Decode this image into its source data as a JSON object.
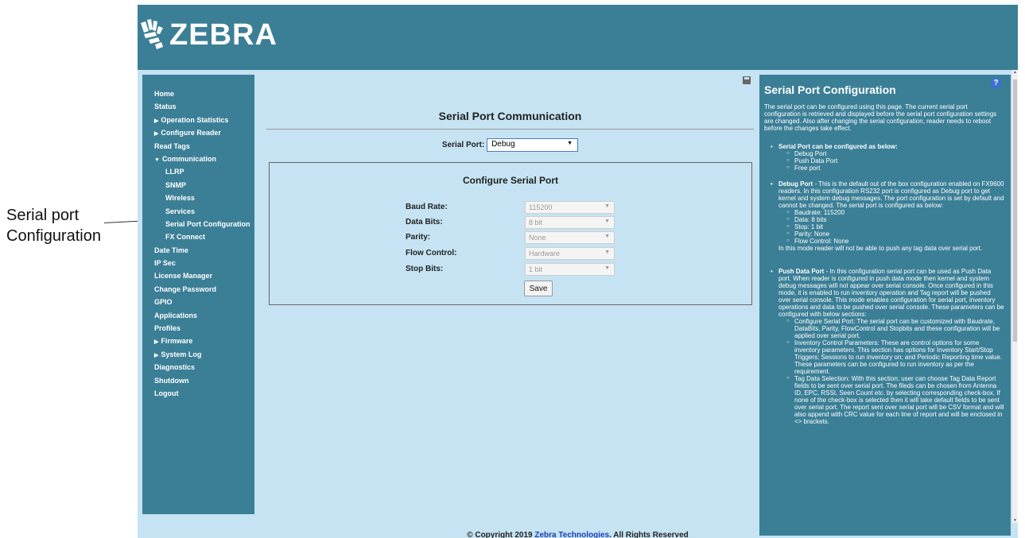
{
  "callout": {
    "line1": "Serial port",
    "line2": "Configuration"
  },
  "brand": {
    "name": "ZEBRA"
  },
  "sidebar": {
    "items": [
      {
        "label": "Home",
        "level": 0,
        "caret": ""
      },
      {
        "label": "Status",
        "level": 0,
        "caret": ""
      },
      {
        "label": "Operation Statistics",
        "level": 0,
        "caret": "▶"
      },
      {
        "label": "Configure Reader",
        "level": 0,
        "caret": "▶"
      },
      {
        "label": "Read Tags",
        "level": 0,
        "caret": ""
      },
      {
        "label": "Communication",
        "level": 0,
        "caret": "▼"
      },
      {
        "label": "LLRP",
        "level": 1,
        "caret": ""
      },
      {
        "label": "SNMP",
        "level": 1,
        "caret": ""
      },
      {
        "label": "Wireless",
        "level": 1,
        "caret": ""
      },
      {
        "label": "Services",
        "level": 1,
        "caret": ""
      },
      {
        "label": "Serial Port Configuration",
        "level": 1,
        "caret": ""
      },
      {
        "label": "FX Connect",
        "level": 1,
        "caret": ""
      },
      {
        "label": "Date Time",
        "level": 0,
        "caret": ""
      },
      {
        "label": "IP Sec",
        "level": 0,
        "caret": ""
      },
      {
        "label": "License Manager",
        "level": 0,
        "caret": ""
      },
      {
        "label": "Change Password",
        "level": 0,
        "caret": ""
      },
      {
        "label": "GPIO",
        "level": 0,
        "caret": ""
      },
      {
        "label": "Applications",
        "level": 0,
        "caret": ""
      },
      {
        "label": "Profiles",
        "level": 0,
        "caret": ""
      },
      {
        "label": "Firmware",
        "level": 0,
        "caret": "▶"
      },
      {
        "label": "System Log",
        "level": 0,
        "caret": "▶"
      },
      {
        "label": "Diagnostics",
        "level": 0,
        "caret": ""
      },
      {
        "label": "Shutdown",
        "level": 0,
        "caret": ""
      },
      {
        "label": "Logout",
        "level": 0,
        "caret": ""
      }
    ]
  },
  "main": {
    "title": "Serial Port Communication",
    "serial_port_label": "Serial Port:",
    "serial_port_value": "Debug",
    "panel_title": "Configure Serial Port",
    "fields": [
      {
        "label": "Baud Rate:",
        "value": "115200"
      },
      {
        "label": "Data Bits:",
        "value": "8 bit"
      },
      {
        "label": "Parity:",
        "value": "None"
      },
      {
        "label": "Flow Control:",
        "value": "Hardware"
      },
      {
        "label": "Stop Bits:",
        "value": "1 bit"
      }
    ],
    "save_label": "Save"
  },
  "help": {
    "title": "Serial Port Configuration",
    "intro": "The serial port can be configured using this page. The current serial port configuration is retrieved and displayed before the serial port configuration settings are changed. Also after changing the serial configuration, reader needs to reboot before the changes take effect.",
    "configurable_heading": "Serial Port can be configured as below:",
    "configurable_items": [
      "Debug Port",
      "Push Data Port",
      "Free port"
    ],
    "debug_heading": "Debug Port",
    "debug_text": " - This is the default out of the box configuration enabled on FX9600 readers. In this configuration RS232 port is configured as Debug port to get kernel and system debug messages. The port configuration is set by default and cannot be changed. The serial port is configured as below:",
    "debug_items": [
      "Baudrate: 115200",
      "Data: 8 bits",
      "Stop: 1 bit",
      "Parity: None",
      "Flow Control: None"
    ],
    "debug_note": "In this mode reader will not be able to push any tag data over serial port.",
    "push_heading": "Push Data Port",
    "push_text": " - In this configuration serial port can be used as Push Data port. When reader is configured in push data mode then kernel and system debug messages will not appear over serial console. Once configured in this mode, it is enabled to run inventory operation and Tag report will be pushed over serial console. This mode enables configuration for serial port, inventory operations and data to be pushed over serial console. These parameters can be configured with below sections:",
    "push_items": [
      "Configure Serial Port: The serial port can be customized with Baudrate, DataBits, Parity, FlowControl and Stopbits and these configuration will be applied over serial port.",
      "Inventory Control Parameters: These are control options for some inventory parameters. This section has options for Inventory Start/Stop Triggers; Sessions to run inventory on; and Periodic Reporting time value. These parameters can be configured to run inventory as per the requirement.",
      "Tag Data Selection: With this section; user can choose Tag Data Report fields to be sent over serial port. The fileds can be chosen from Antenna ID, EPC, RSSI, Seen Count etc. by selecting corresponding check-box. If none of the check-box is selected then it will take default fields to be sent over serial port. The report sent over serial port will be CSV format and will also append with CRC value for each line of report and will be enclosed in <> brackets."
    ]
  },
  "footer": {
    "prefix": "© Copyright 2019 ",
    "link": "Zebra Technologies",
    "suffix": ". All Rights Reserved"
  }
}
